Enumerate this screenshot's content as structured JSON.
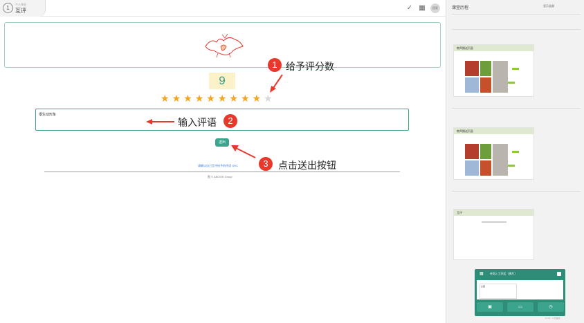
{
  "topbar": {
    "tab_number": "1",
    "tab_small_text": "个人作业",
    "tab_label": "互评",
    "right_badge": "回家"
  },
  "score": {
    "value": "9",
    "stars_on": 9,
    "stars_total": 10
  },
  "annotations": {
    "one_number": "1",
    "one_text": "给予评分数",
    "two_number": "2",
    "two_text": "输入评语",
    "three_number": "3",
    "three_text": "点击送出按钮"
  },
  "comment": {
    "label": "很生动形象"
  },
  "send": {
    "label": "送出"
  },
  "footer": {
    "link": "请确认自己互评给予的评语 ORC",
    "copyright": "图 © ABOOK Group"
  },
  "right_panel": {
    "title": "课堂历程",
    "show_all": "显示全部",
    "cards": [
      {
        "title": "教师播送页面"
      },
      {
        "title": "教师播送页面"
      },
      {
        "title": "互评"
      }
    ],
    "widget": {
      "title": "任务2-工作区（图片）",
      "preview_label": "全图",
      "time": "17:37 · 5 已提交"
    }
  }
}
